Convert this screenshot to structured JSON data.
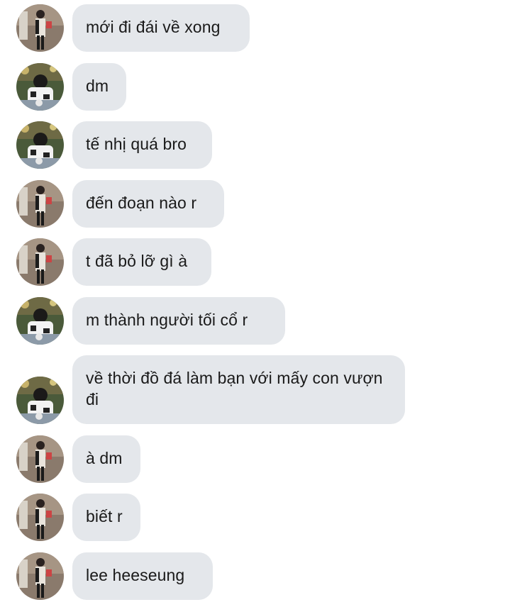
{
  "conversation": {
    "messages": [
      {
        "sender": "avatar-a",
        "text": "mới đi đái về xong"
      },
      {
        "sender": "avatar-b",
        "text": "dm"
      },
      {
        "sender": "avatar-b",
        "text": "tế nhị quá bro"
      },
      {
        "sender": "avatar-a",
        "text": "đến đoạn nào r"
      },
      {
        "sender": "avatar-a",
        "text": "t đã bỏ lỡ gì à"
      },
      {
        "sender": "avatar-b",
        "text": "m thành người tối cổ r"
      },
      {
        "sender": "avatar-b",
        "text": "về thời đồ đá làm bạn với mấy con vượn đi"
      },
      {
        "sender": "avatar-a",
        "text": "à dm"
      },
      {
        "sender": "avatar-a",
        "text": "biết r"
      },
      {
        "sender": "avatar-a",
        "text": "lee heeseung"
      }
    ]
  },
  "colors": {
    "bubble_bg": "#e4e7eb",
    "text": "#1a1a1a",
    "background": "#ffffff"
  }
}
